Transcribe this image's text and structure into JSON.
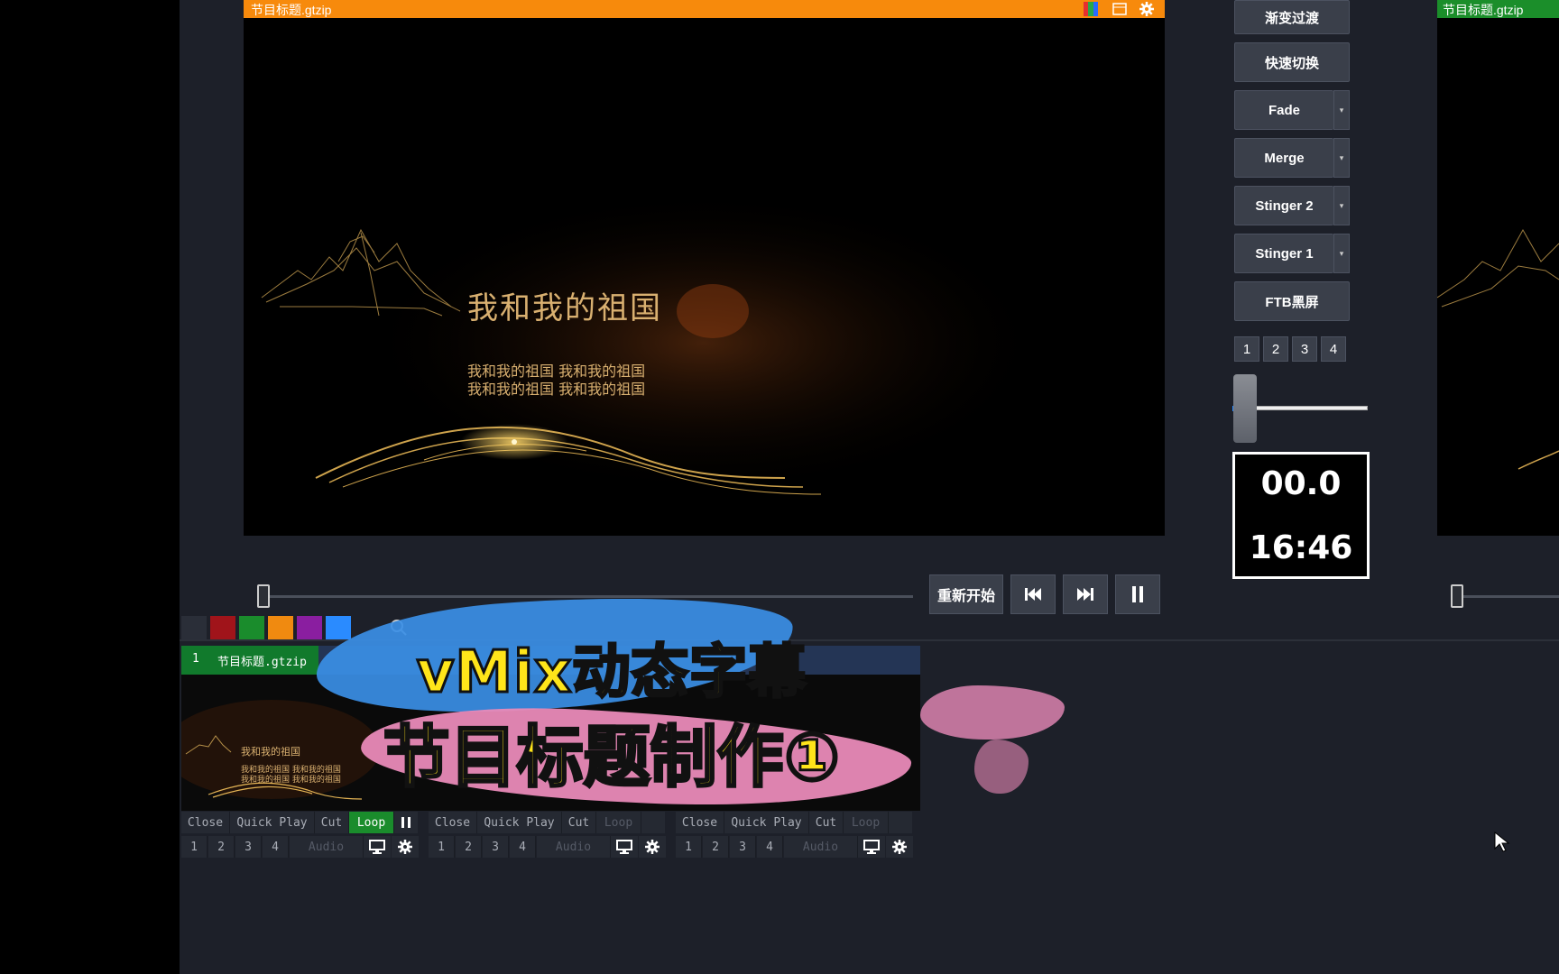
{
  "preview": {
    "title": "节目标题.gtzip",
    "main_title": "我和我的祖国",
    "sub_line_1": "我和我的祖国 我和我的祖国",
    "sub_line_2": "我和我的祖国 我和我的祖国"
  },
  "output": {
    "title": "节目标题.gtzip"
  },
  "transitions": {
    "fade_transition": "渐变过渡",
    "quick_cut": "快速切换",
    "fade": "Fade",
    "merge": "Merge",
    "stinger2": "Stinger 2",
    "stinger1": "Stinger 1",
    "ftb": "FTB黑屏",
    "numbers": [
      "1",
      "2",
      "3",
      "4"
    ],
    "tbar_position": 0.08
  },
  "timer": {
    "line1": "00.0",
    "line2": "16:46"
  },
  "playback": {
    "restart": "重新开始"
  },
  "colors": {
    "preview_bar": "#f78a0c",
    "output_bar": "#1b8e2a",
    "swatches": [
      "#2a2e38",
      "#a0141a",
      "#1a8c2c",
      "#f08a10",
      "#8a1ea0",
      "#2a8bff"
    ]
  },
  "input": {
    "number": "1",
    "name": "节目标题.gtzip",
    "thumb_title": "我和我的祖国",
    "thumb_line": "我和我的祖国 我和我的祖国"
  },
  "overlay": {
    "line1": "vMix动态字幕",
    "line2": "节目标题制作①"
  },
  "controls": [
    {
      "close": "Close",
      "quick_play": "Quick Play",
      "cut": "Cut",
      "loop": "Loop",
      "loop_on": true,
      "nums": [
        "1",
        "2",
        "3",
        "4"
      ],
      "audio": "Audio"
    },
    {
      "close": "Close",
      "quick_play": "Quick Play",
      "cut": "Cut",
      "loop": "Loop",
      "loop_on": false,
      "nums": [
        "1",
        "2",
        "3",
        "4"
      ],
      "audio": "Audio"
    },
    {
      "close": "Close",
      "quick_play": "Quick Play",
      "cut": "Cut",
      "loop": "Loop",
      "loop_on": false,
      "nums": [
        "1",
        "2",
        "3",
        "4"
      ],
      "audio": "Audio"
    }
  ]
}
